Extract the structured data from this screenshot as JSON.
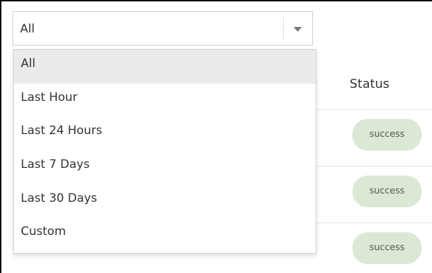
{
  "filter": {
    "selected_value": "All",
    "options": [
      {
        "label": "All",
        "selected": true
      },
      {
        "label": "Last Hour",
        "selected": false
      },
      {
        "label": "Last 24 Hours",
        "selected": false
      },
      {
        "label": "Last 7 Days",
        "selected": false
      },
      {
        "label": "Last 30 Days",
        "selected": false
      },
      {
        "label": "Custom",
        "selected": false
      }
    ]
  },
  "table": {
    "columns": [
      "Status"
    ],
    "rows": [
      {
        "status": "success"
      },
      {
        "status": "success"
      },
      {
        "status": "success"
      }
    ]
  },
  "colors": {
    "selected_option_bg": "#ebebeb",
    "success_badge_bg": "#dce8d6",
    "success_badge_text": "#4d5a4a"
  }
}
